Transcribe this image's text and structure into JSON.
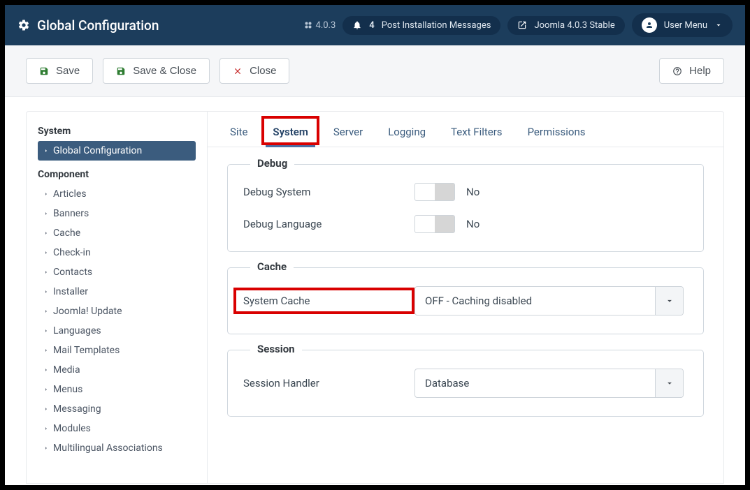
{
  "header": {
    "title": "Global Configuration",
    "version": "4.0.3",
    "notification_count": "4",
    "notification_label": "Post Installation Messages",
    "stable_label": "Joomla 4.0.3 Stable",
    "user_menu": "User Menu"
  },
  "toolbar": {
    "save": "Save",
    "save_close": "Save & Close",
    "close": "Close",
    "help": "Help"
  },
  "sidebar": {
    "section1": "System",
    "active_item": "Global Configuration",
    "section2": "Component",
    "items": [
      "Articles",
      "Banners",
      "Cache",
      "Check-in",
      "Contacts",
      "Installer",
      "Joomla! Update",
      "Languages",
      "Mail Templates",
      "Media",
      "Menus",
      "Messaging",
      "Modules",
      "Multilingual Associations"
    ]
  },
  "tabs": [
    "Site",
    "System",
    "Server",
    "Logging",
    "Text Filters",
    "Permissions"
  ],
  "fieldsets": {
    "debug": {
      "legend": "Debug",
      "rows": [
        {
          "label": "Debug System",
          "value": "No"
        },
        {
          "label": "Debug Language",
          "value": "No"
        }
      ]
    },
    "cache": {
      "legend": "Cache",
      "row_label": "System Cache",
      "row_value": "OFF - Caching disabled"
    },
    "session": {
      "legend": "Session",
      "row_label": "Session Handler",
      "row_value": "Database"
    }
  }
}
